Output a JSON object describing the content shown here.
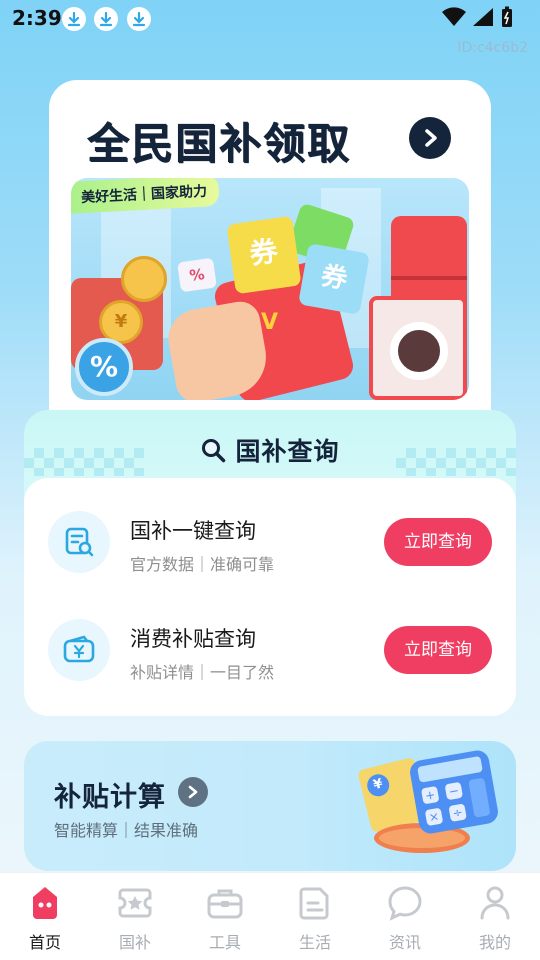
{
  "status_bar": {
    "time": "2:39",
    "page_id": "ID:c4c6b2"
  },
  "banner": {
    "title": "全民国补领取",
    "tag": "美好生活｜国家助力",
    "image_glyphs": {
      "coupon_1": "券",
      "coupon_2": "券",
      "check": "V",
      "percent_small": "%",
      "percent_badge": "%",
      "yuan": "¥"
    }
  },
  "query": {
    "title": "国补查询",
    "items": [
      {
        "title": "国补一键查询",
        "subtitle": "官方数据｜准确可靠",
        "button": "立即查询",
        "icon": "document-search-icon"
      },
      {
        "title": "消费补贴查询",
        "subtitle": "补贴详情｜一目了然",
        "button": "立即查询",
        "icon": "wallet-yuan-icon"
      }
    ]
  },
  "calc": {
    "title": "补贴计算",
    "subtitle": "智能精算｜结果准确",
    "glyphs": {
      "yuan": "¥",
      "plus": "+",
      "minus": "−",
      "times": "×",
      "divide": "÷"
    }
  },
  "bottom_nav": {
    "items": [
      {
        "label": "首页",
        "icon": "home-icon",
        "active": true
      },
      {
        "label": "国补",
        "icon": "ticket-star-icon",
        "active": false
      },
      {
        "label": "工具",
        "icon": "toolbox-icon",
        "active": false
      },
      {
        "label": "生活",
        "icon": "document-icon",
        "active": false
      },
      {
        "label": "资讯",
        "icon": "chat-icon",
        "active": false
      },
      {
        "label": "我的",
        "icon": "person-icon",
        "active": false
      }
    ]
  },
  "colors": {
    "accent_pink": "#f03e62",
    "title_navy": "#14243b",
    "background_sky": "#7fd3f7"
  }
}
